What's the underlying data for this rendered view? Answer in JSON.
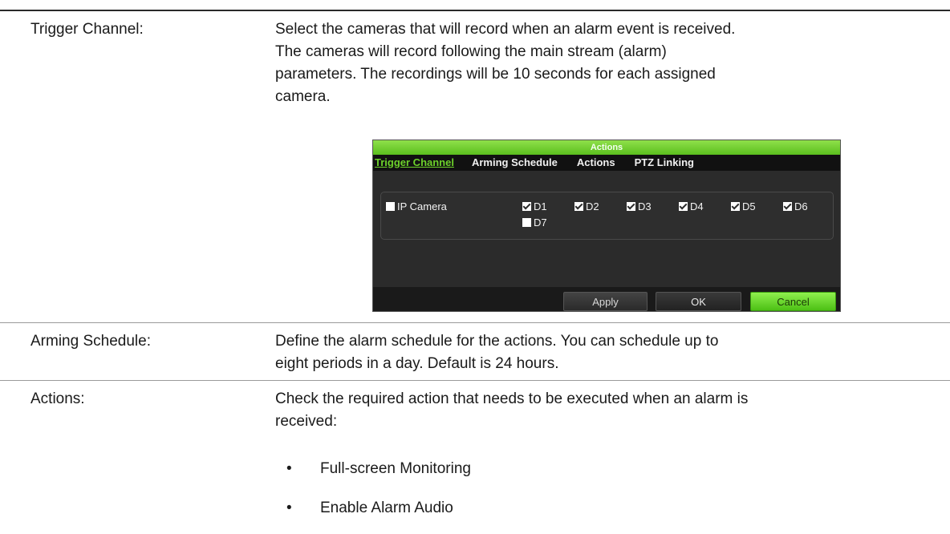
{
  "rows": {
    "trigger": {
      "label": "Trigger Channel:",
      "desc_lines": [
        "Select the cameras that will record when an alarm event is received.",
        "The cameras will record following the main stream (alarm)",
        "parameters. The recordings will be 10 seconds for each assigned",
        "camera."
      ]
    },
    "arming": {
      "label": "Arming Schedule:",
      "desc_lines": [
        "Define the alarm schedule for the actions. You can schedule up to",
        "eight periods in a day. Default is 24 hours."
      ]
    },
    "actions": {
      "label": "Actions:",
      "desc_lines": [
        "Check the required action that needs to be executed when an alarm is",
        "received:"
      ],
      "bullets": [
        "Full-screen Monitoring",
        "Enable Alarm Audio"
      ],
      "bullet_glyph": "•"
    }
  },
  "dialog": {
    "title": "Actions",
    "tabs": [
      "Trigger Channel",
      "Arming Schedule",
      "Actions",
      "PTZ Linking"
    ],
    "active_tab": "Trigger Channel",
    "ip_camera": {
      "label": "IP Camera",
      "checked": false
    },
    "channels": [
      {
        "label": "D1",
        "checked": true
      },
      {
        "label": "D2",
        "checked": true
      },
      {
        "label": "D3",
        "checked": true
      },
      {
        "label": "D4",
        "checked": true
      },
      {
        "label": "D5",
        "checked": true
      },
      {
        "label": "D6",
        "checked": true
      },
      {
        "label": "D7",
        "checked": false
      }
    ],
    "buttons": {
      "apply": "Apply",
      "ok": "OK",
      "cancel": "Cancel"
    },
    "colors": {
      "accent": "#6dd12b",
      "background": "#2b2b2b",
      "title_bar": "#7dd83a"
    }
  }
}
